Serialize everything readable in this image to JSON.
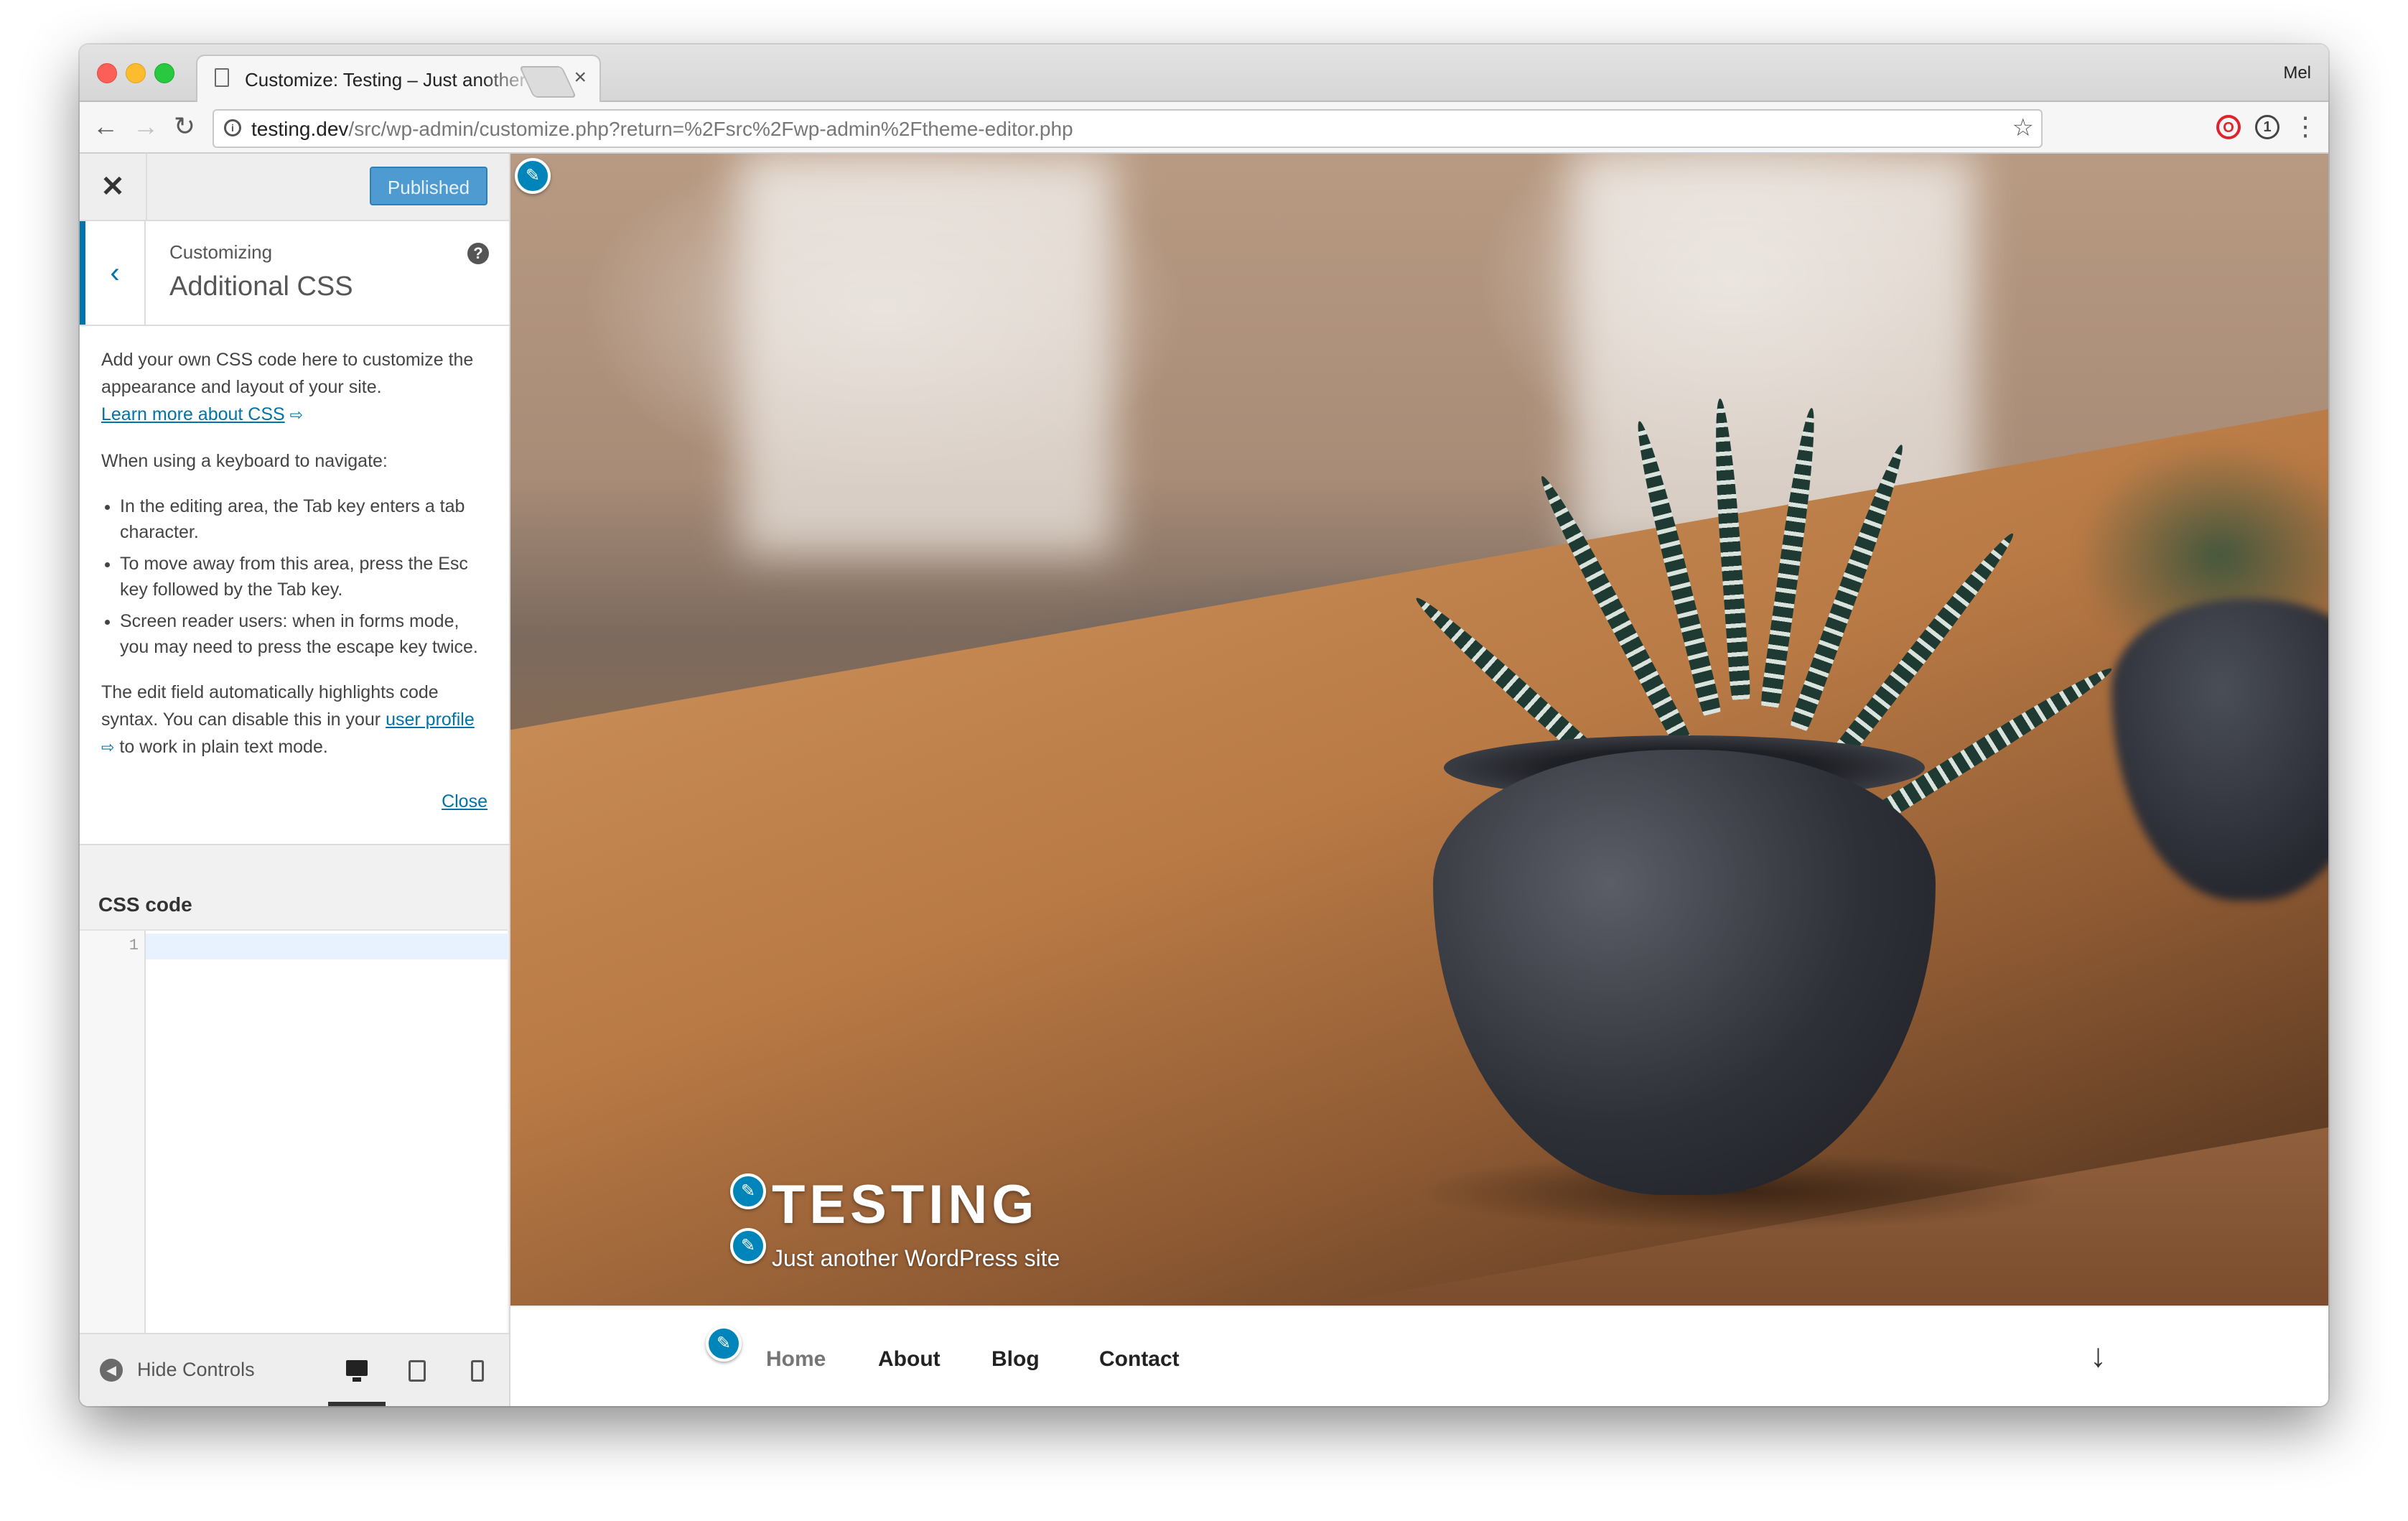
{
  "browser": {
    "tab_title": "Customize: Testing – Just another WordPress site",
    "tab_close": "×",
    "user": "Mel",
    "url_host": "testing.dev",
    "url_path": "/src/wp-admin/customize.php?return=%2Fsrc%2Fwp-admin%2Ftheme-editor.php",
    "icons": {
      "back": "←",
      "forward": "→",
      "reload": "↻",
      "star": "☆",
      "info": "i",
      "menu": "⋮"
    }
  },
  "customizer": {
    "close_symbol": "✕",
    "publish_label": "Published",
    "customizing_label": "Customizing",
    "section_title": "Additional CSS",
    "back_symbol": "‹",
    "help_symbol": "?",
    "description": {
      "intro": "Add your own CSS code here to customize the appearance and layout of your site.",
      "learn_more": "Learn more about CSS",
      "keyboard_heading": "When using a keyboard to navigate:",
      "tips": [
        "In the editing area, the Tab key enters a tab character.",
        "To move away from this area, press the Esc key followed by the Tab key.",
        "Screen reader users: when in forms mode, you may need to press the escape key twice."
      ],
      "highlight_pre": "The edit field automatically highlights code syntax. You can disable this in your ",
      "user_profile_link": "user profile",
      "highlight_post": " to work in plain text mode.",
      "close_link": "Close"
    },
    "css_code_label": "CSS code",
    "editor_line_number": "1",
    "editor_content": "",
    "footer": {
      "hide_controls_label": "Hide Controls",
      "active_device": "desktop"
    },
    "accent_color": "#0073aa"
  },
  "preview": {
    "site_title": "TESTING",
    "tagline": "Just another WordPress site",
    "nav_items": [
      "Home",
      "About",
      "Blog",
      "Contact"
    ],
    "scroll_arrow": "↓",
    "edit_shortcut_symbol": "✎"
  }
}
